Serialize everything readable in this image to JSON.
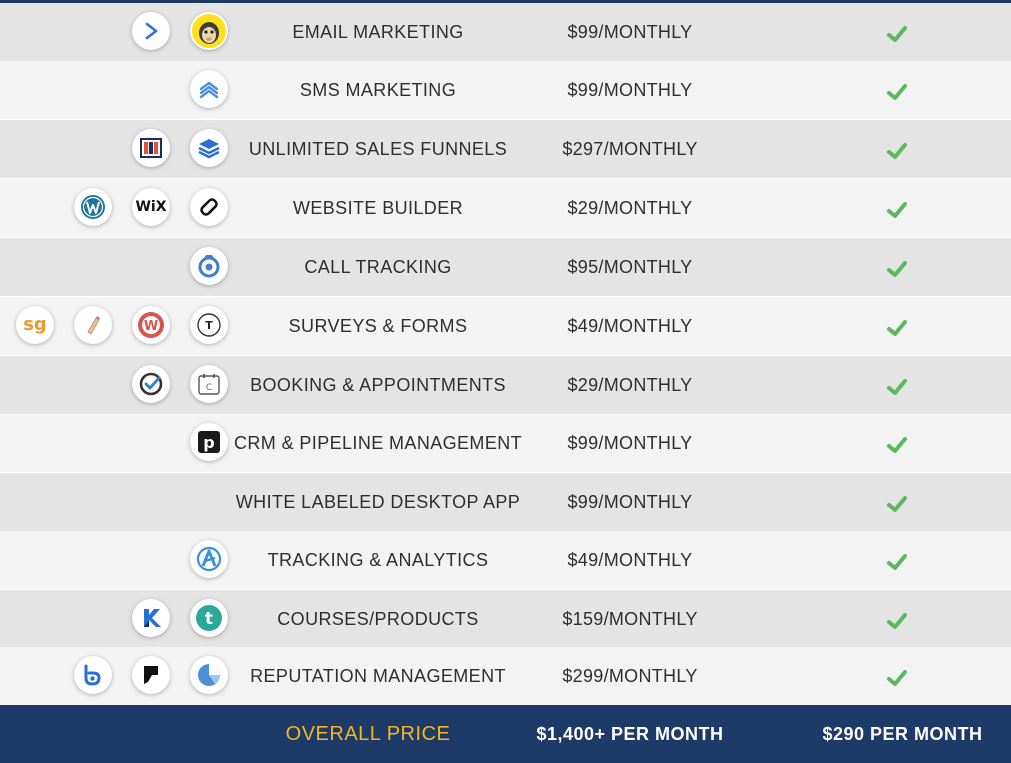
{
  "colors": {
    "row_dark": "#e4e4e4",
    "row_light": "#f3f3f3",
    "check": "#5cb85c",
    "footer_bg": "#1e3a68",
    "footer_label": "#f4b81e",
    "footer_text": "#ffffff"
  },
  "rows": [
    {
      "feature": "EMAIL MARKETING",
      "price": "$99/MONTHLY",
      "included": "check-icon",
      "logos": [
        "activecampaign-icon",
        "mailchimp-icon"
      ]
    },
    {
      "feature": "SMS MARKETING",
      "price": "$99/MONTHLY",
      "included": "check-icon",
      "logos": [
        "chevrons-up-icon"
      ]
    },
    {
      "feature": "UNLIMITED SALES FUNNELS",
      "price": "$297/MONTHLY",
      "included": "check-icon",
      "logos": [
        "clickfunnels-icon",
        "layers-icon"
      ]
    },
    {
      "feature": "WEBSITE BUILDER",
      "price": "$29/MONTHLY",
      "included": "check-icon",
      "logos": [
        "wordpress-icon",
        "wix-icon",
        "squarespace-icon"
      ]
    },
    {
      "feature": "CALL TRACKING",
      "price": "$95/MONTHLY",
      "included": "check-icon",
      "logos": [
        "calltracking-icon"
      ]
    },
    {
      "feature": "SURVEYS & FORMS",
      "price": "$49/MONTHLY",
      "included": "check-icon",
      "logos": [
        "surveygizmo-icon",
        "pencil-icon",
        "wufoo-icon",
        "typeform-icon"
      ]
    },
    {
      "feature": "BOOKING & APPOINTMENTS",
      "price": "$29/MONTHLY",
      "included": "check-icon",
      "logos": [
        "acuity-icon",
        "calendly-icon"
      ]
    },
    {
      "feature": "CRM & PIPELINE MANAGEMENT",
      "price": "$99/MONTHLY",
      "included": "check-icon",
      "logos": [
        "pipedrive-icon"
      ]
    },
    {
      "feature": "WHITE LABELED DESKTOP APP",
      "price": "$99/MONTHLY",
      "included": "check-icon",
      "logos": []
    },
    {
      "feature": "TRACKING & ANALYTICS",
      "price": "$49/MONTHLY",
      "included": "check-icon",
      "logos": [
        "analytics-icon"
      ]
    },
    {
      "feature": "COURSES/PRODUCTS",
      "price": "$159/MONTHLY",
      "included": "check-icon",
      "logos": [
        "kajabi-icon",
        "teachable-icon"
      ]
    },
    {
      "feature": "REPUTATION MANAGEMENT",
      "price": "$299/MONTHLY",
      "included": "check-icon",
      "logos": [
        "birdeye-icon",
        "foursquare-icon",
        "pie-chart-icon"
      ]
    }
  ],
  "logo_text": {
    "wix": "WiX",
    "surveygizmo": "sg",
    "wufoo": "W",
    "typeform": "T",
    "pipedrive": "p",
    "teachable": "t",
    "calendly": "C"
  },
  "footer": {
    "label": "OVERALL PRICE",
    "competitor_price": "$1,400+ PER MONTH",
    "our_price": "$290 PER MONTH"
  }
}
